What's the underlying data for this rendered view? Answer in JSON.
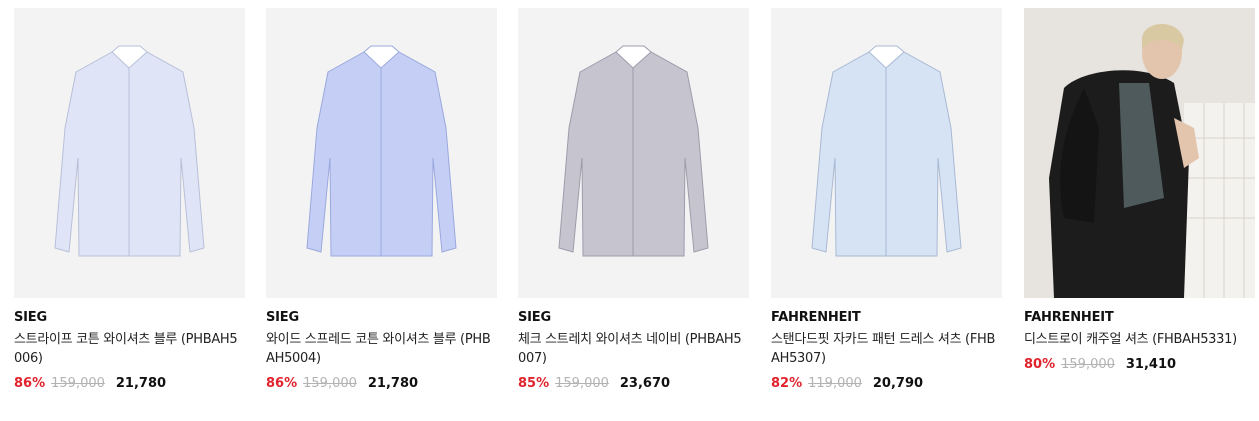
{
  "colors": {
    "discount": "#e0232d",
    "original_price": "#b3b3b3",
    "card_background": "#f3f3f3"
  },
  "products": [
    {
      "image_icon": "shirt-image",
      "shirt_color": "#dfe5f7",
      "brand": "SIEG",
      "name": "스트라이프 코튼 와이셔츠 블루 (PHBAH5006)",
      "discount": "86%",
      "original_price": "159,000",
      "price": "21,780"
    },
    {
      "image_icon": "shirt-image",
      "shirt_color": "#c5cff5",
      "brand": "SIEG",
      "name": "와이드 스프레드 코튼 와이셔츠 블루 (PHBAH5004)",
      "discount": "86%",
      "original_price": "159,000",
      "price": "21,780"
    },
    {
      "image_icon": "shirt-image",
      "shirt_color": "#c6c4cf",
      "brand": "SIEG",
      "name": "체크 스트레치 와이셔츠 네이비 (PHBAH5007)",
      "discount": "85%",
      "original_price": "159,000",
      "price": "23,670"
    },
    {
      "image_icon": "shirt-image",
      "shirt_color": "#d6e3f4",
      "brand": "FAHRENHEIT",
      "name": "스탠다드핏 자카드 패턴 드레스 셔츠 (FHBAH5307)",
      "discount": "82%",
      "original_price": "119,000",
      "price": "20,790"
    },
    {
      "image_icon": "model-photo",
      "brand": "FAHRENHEIT",
      "name": "디스트로이 캐주얼 셔츠 (FHBAH5331)",
      "discount": "80%",
      "original_price": "159,000",
      "price": "31,410"
    }
  ]
}
